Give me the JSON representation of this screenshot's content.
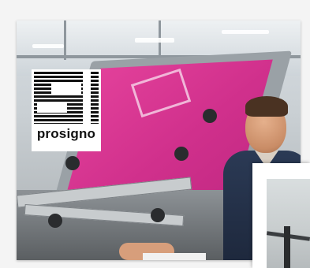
{
  "brand": {
    "logo_text": "prosigno"
  },
  "colors": {
    "screen_pink": "#d0308c",
    "logo_black": "#111111",
    "card_background": "#ffffff"
  },
  "icons": {
    "logo": "prosigno-s-logo"
  }
}
